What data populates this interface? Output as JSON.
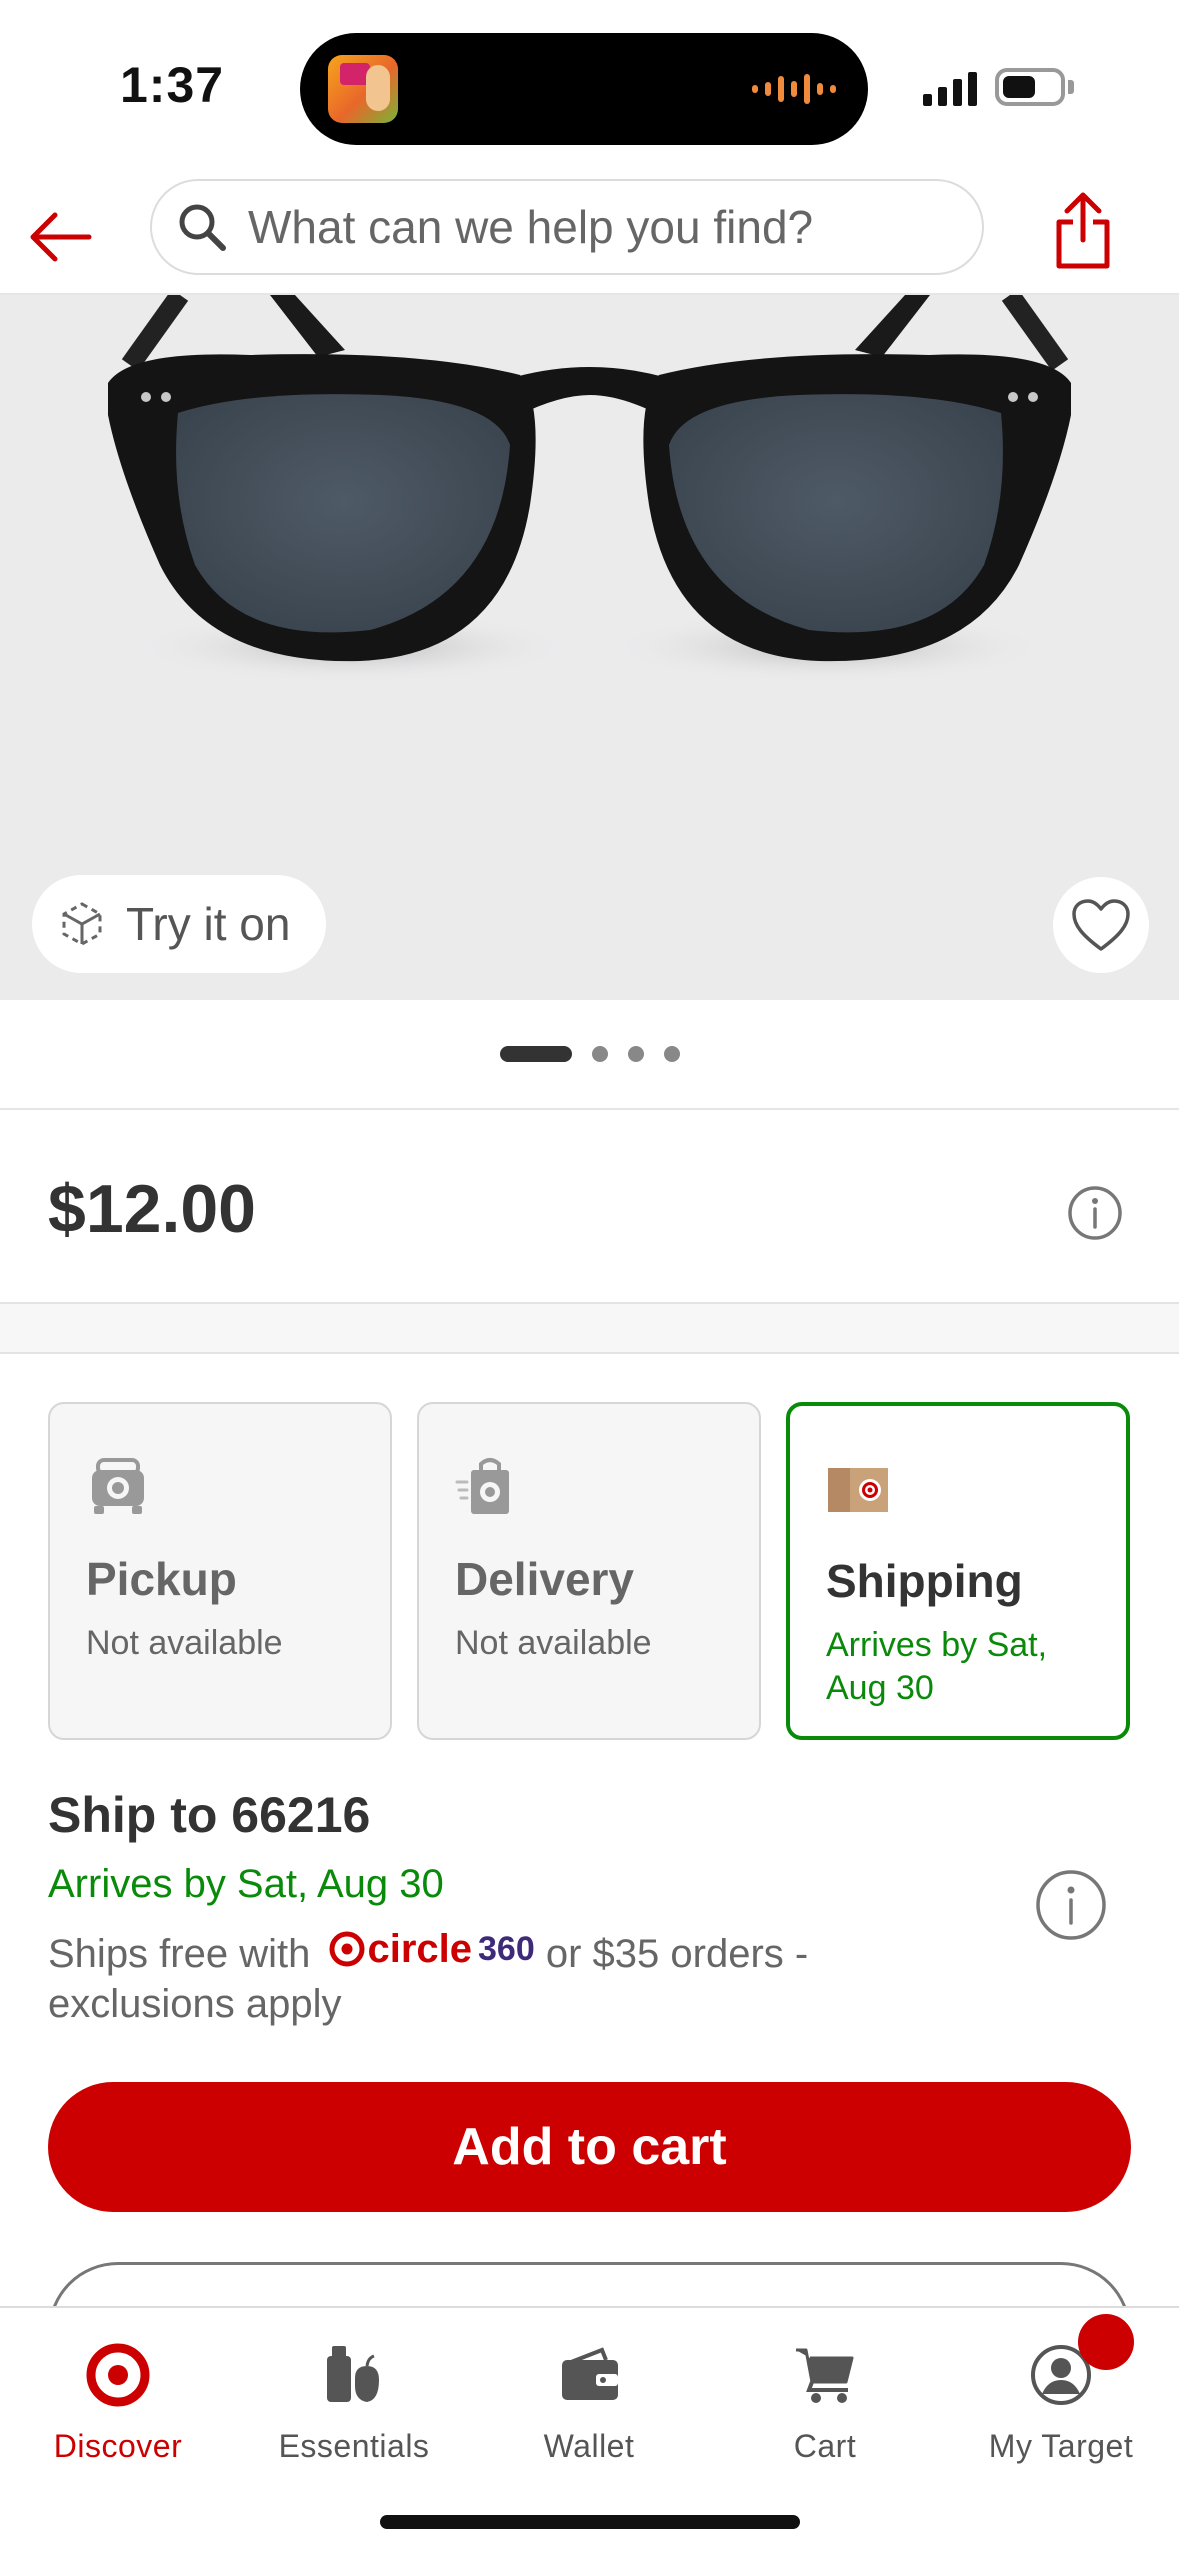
{
  "status_bar": {
    "time": "1:37"
  },
  "header": {
    "search_placeholder": "What can we help you find?"
  },
  "product": {
    "try_on_label": "Try it on",
    "price": "$12.00",
    "carousel": {
      "total": 4,
      "active": 1
    }
  },
  "fulfillment": {
    "options": [
      {
        "title": "Pickup",
        "subtitle": "Not available",
        "selected": false,
        "icon": "pickup-car-icon"
      },
      {
        "title": "Delivery",
        "subtitle": "Not available",
        "selected": false,
        "icon": "delivery-bag-icon"
      },
      {
        "title": "Shipping",
        "subtitle": "Arrives by Sat, Aug 30",
        "selected": true,
        "icon": "shipping-box-icon"
      }
    ]
  },
  "shipping": {
    "ship_to": "Ship to 66216",
    "arrives": "Arrives by Sat, Aug 30",
    "note_prefix": "Ships free with",
    "circle_brand": "circle",
    "circle_360": "360",
    "note_suffix": " or $35 orders - exclusions apply"
  },
  "actions": {
    "add_to_cart": "Add to cart"
  },
  "tab_bar": {
    "items": [
      {
        "label": "Discover",
        "icon": "target-bullseye-icon",
        "active": true
      },
      {
        "label": "Essentials",
        "icon": "essentials-icon",
        "active": false
      },
      {
        "label": "Wallet",
        "icon": "wallet-icon",
        "active": false
      },
      {
        "label": "Cart",
        "icon": "cart-icon",
        "active": false
      },
      {
        "label": "My Target",
        "icon": "profile-icon",
        "active": false
      }
    ]
  },
  "colors": {
    "brand_red": "#cc0000",
    "success_green": "#0a8a0a",
    "text_dark": "#333333",
    "text_muted": "#666666"
  }
}
